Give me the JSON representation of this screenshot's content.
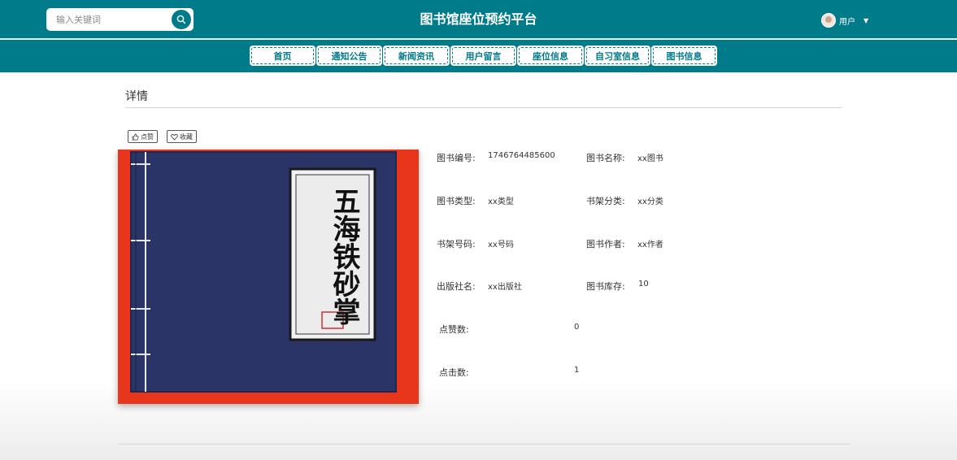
{
  "header": {
    "site_title": "图书馆座位预约平台",
    "search_placeholder": "输入关键词",
    "user_label": "用户",
    "brand_color": "#007b89"
  },
  "nav": {
    "items": [
      {
        "label": "首页"
      },
      {
        "label": "通知公告"
      },
      {
        "label": "新闻资讯"
      },
      {
        "label": "用户留言"
      },
      {
        "label": "座位信息"
      },
      {
        "label": "自习室信息"
      },
      {
        "label": "图书信息"
      }
    ]
  },
  "detail": {
    "section_title": "详情",
    "like_label": "点赞",
    "favorite_label": "收藏",
    "book_cover_text": "五海铁砂掌",
    "fields": {
      "book_no": {
        "label": "图书编号:",
        "value": "1746764485600"
      },
      "book_name": {
        "label": "图书名称:",
        "value": "xx图书"
      },
      "book_type": {
        "label": "图书类型:",
        "value": "xx类型"
      },
      "shelf_category": {
        "label": "书架分类:",
        "value": "xx分类"
      },
      "shelf_no": {
        "label": "书架号码:",
        "value": "xx号码"
      },
      "author": {
        "label": "图书作者:",
        "value": "xx作者"
      },
      "publisher": {
        "label": "出版社名:",
        "value": "xx出版社"
      },
      "stock": {
        "label": "图书库存:",
        "value": "10"
      },
      "likes": {
        "label": "点赞数:",
        "value": "0"
      },
      "clicks": {
        "label": "点击数:",
        "value": "1"
      }
    }
  }
}
